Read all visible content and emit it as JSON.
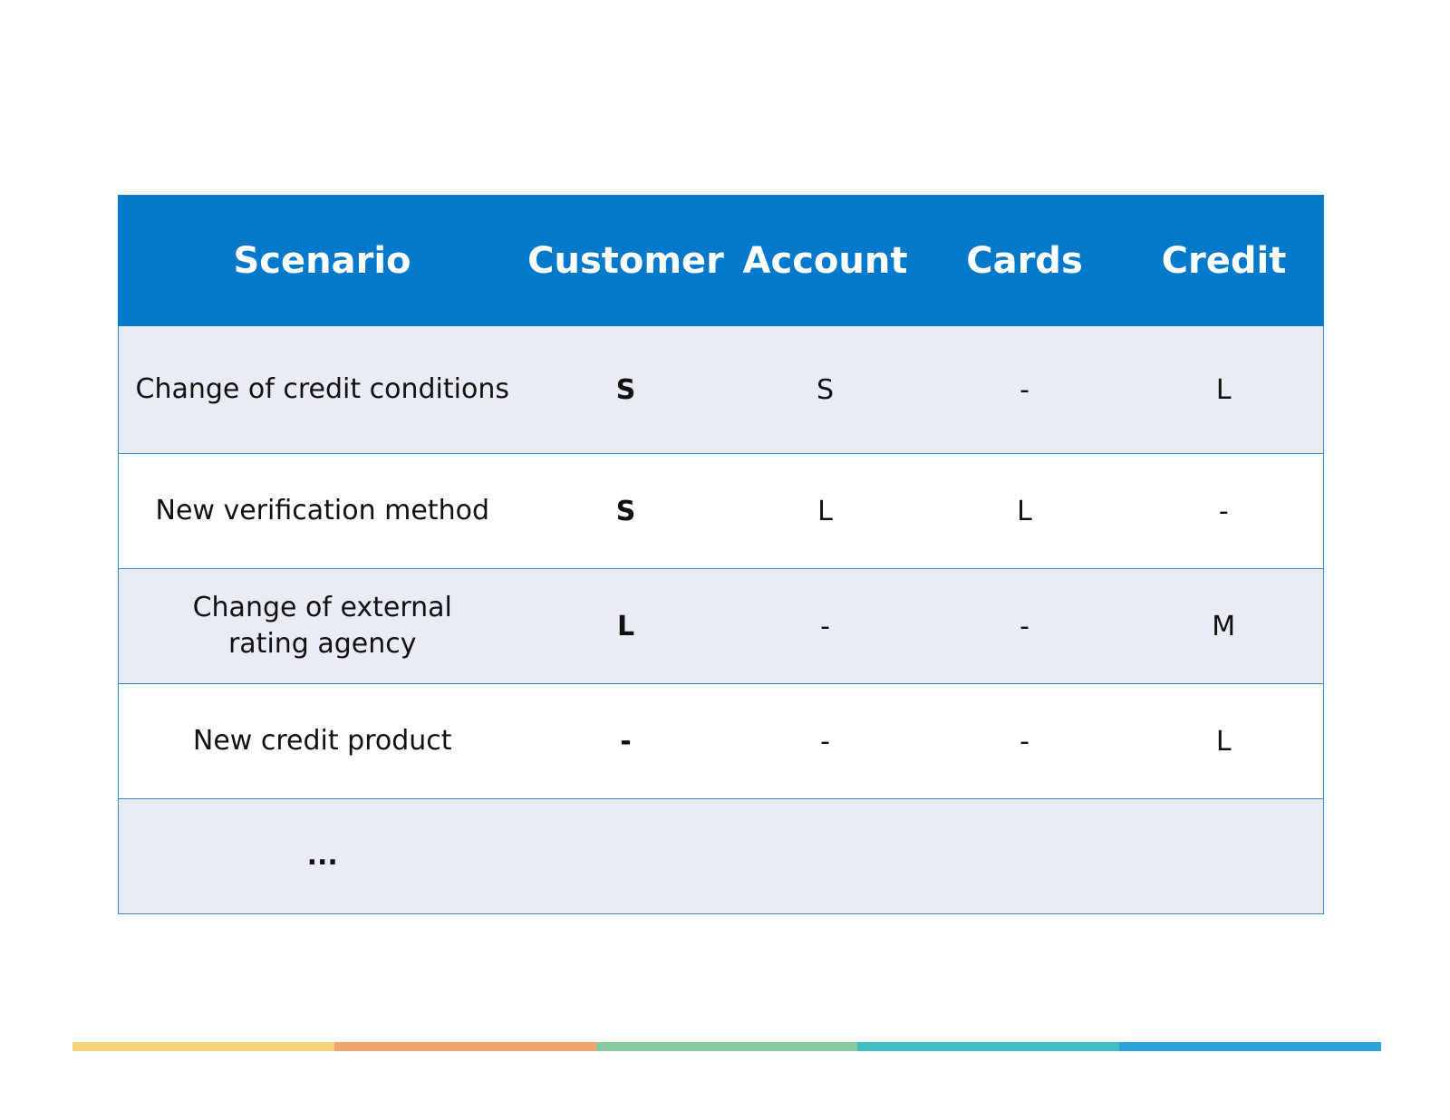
{
  "table": {
    "headers": [
      "Scenario",
      "Customer",
      "Account",
      "Cards",
      "Credit"
    ],
    "rows": [
      [
        "Change of credit conditions",
        "S",
        "S",
        "-",
        "L"
      ],
      [
        "New verification method",
        "S",
        "L",
        "L",
        "-"
      ],
      [
        "Change of external rating agency",
        "L",
        "-",
        "-",
        "M"
      ],
      [
        "New credit product",
        "-",
        "-",
        "-",
        "L"
      ],
      [
        "...",
        "",
        "",
        "",
        ""
      ]
    ]
  },
  "colors": {
    "header_bg": "#0279cb",
    "row_shade": "#e9ecf4",
    "border": "#3a86d0",
    "stripe": [
      "#f6d37c",
      "#f2a56b",
      "#86cba0",
      "#3fbec4",
      "#2aa3d8"
    ]
  }
}
